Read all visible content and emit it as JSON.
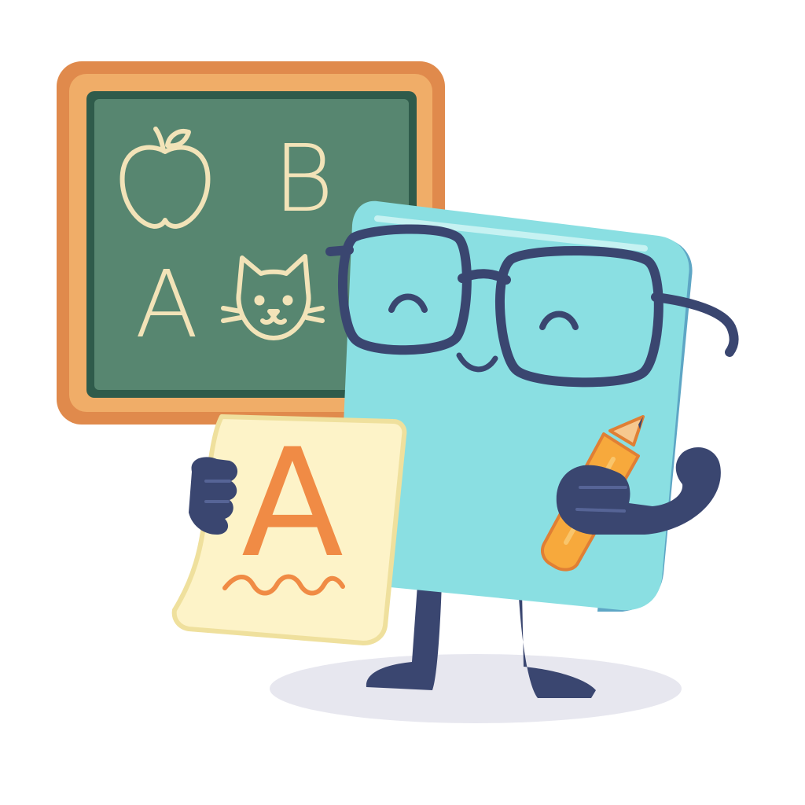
{
  "illustration": {
    "chalkboard": {
      "letters": [
        "B",
        "A"
      ],
      "icons": [
        "apple-icon",
        "cat-face-icon"
      ]
    },
    "paper": {
      "letter": "A",
      "icons": [
        "squiggle-line-icon"
      ]
    },
    "character": {
      "icons": [
        "glasses-icon",
        "pencil-icon"
      ]
    }
  },
  "colors": {
    "background": "#ffffff",
    "frame_outer": "#e08a4c",
    "frame_inner": "#f0ad68",
    "board": "#578670",
    "board_border": "#2f5b4b",
    "chalk": "#f2e3b8",
    "book_front": "#8adfe2",
    "book_side": "#5ea6c5",
    "outline_navy": "#3a4670",
    "paper": "#fdf3c8",
    "paper_border": "#efe09d",
    "paper_ink": "#f08b45",
    "pencil": "#f7a93c",
    "shadow": "#e7e7ef"
  }
}
